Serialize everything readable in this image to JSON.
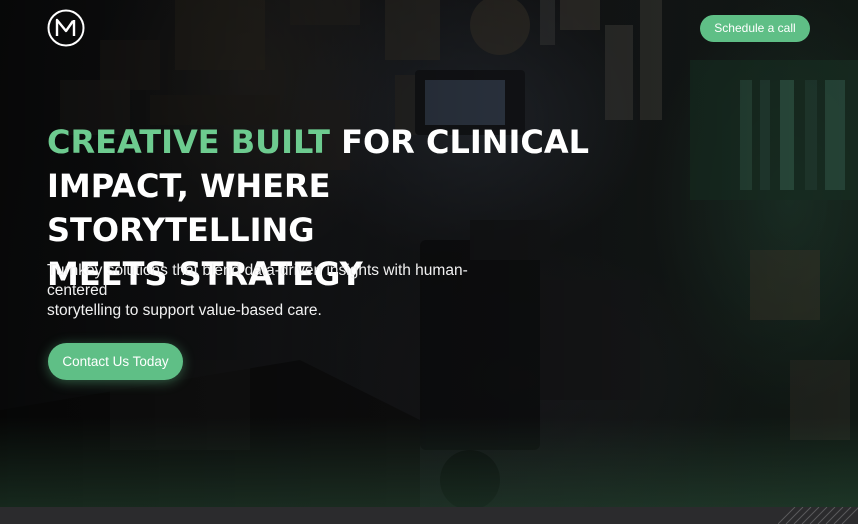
{
  "header": {
    "logo_icon": "m-monogram-logo",
    "schedule_label": "Schedule a call"
  },
  "hero": {
    "headline_accent": "CREATIVE BUILT",
    "headline_line1_rest": " FOR CLINICAL",
    "headline_line2": "IMPACT, WHERE STORYTELLING",
    "headline_line3": "MEETS STRATEGY",
    "subtitle_line1": "Turnkey solutions that blend data-driven insights with human-centered",
    "subtitle_line2": "storytelling to support value-based care.",
    "cta_label": "Contact Us Today"
  },
  "colors": {
    "accent": "#6dcb8f",
    "button": "#5fbf86",
    "text": "#ffffff",
    "bottom_bar": "#2b2b2d"
  }
}
